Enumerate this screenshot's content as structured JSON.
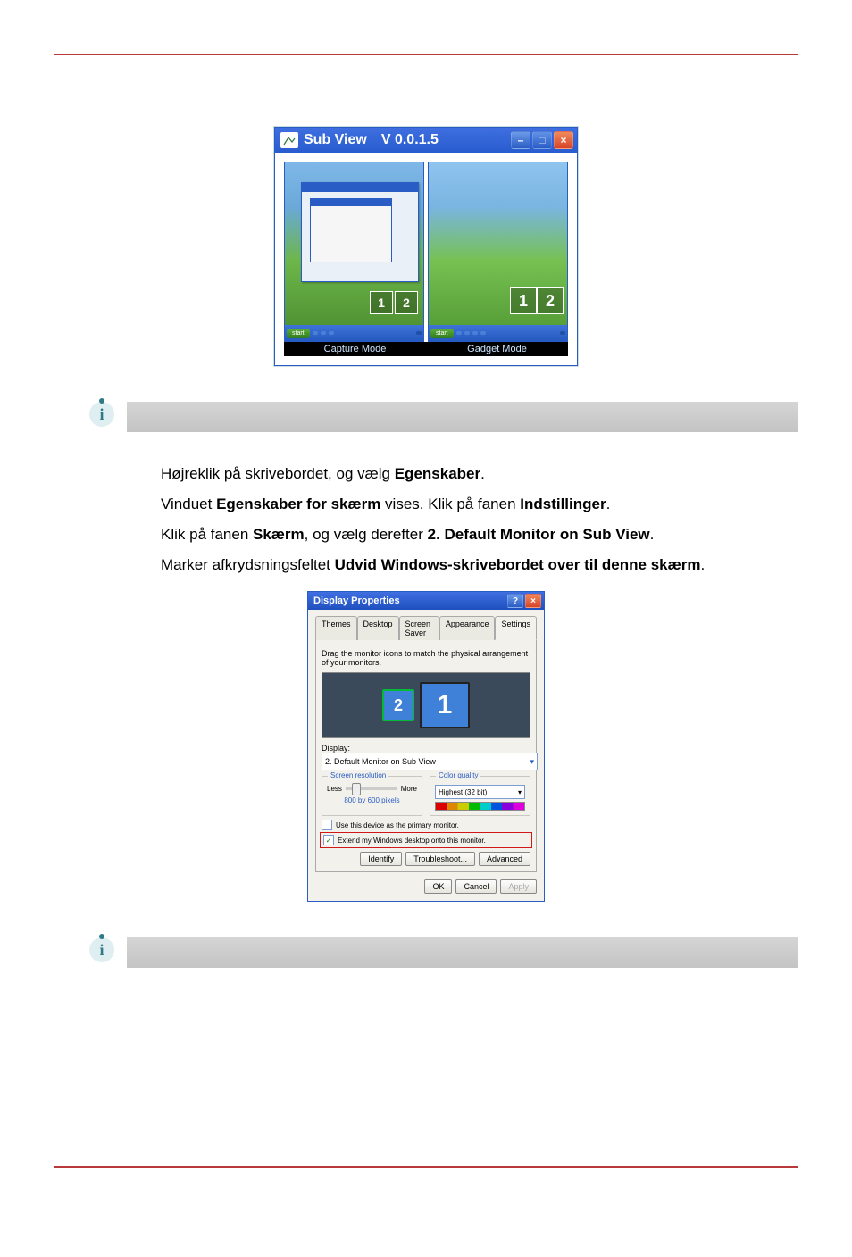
{
  "subview": {
    "title_prefix": "Sub View",
    "version": "V 0.0.1.5",
    "left_mode": "Capture Mode",
    "right_mode": "Gadget Mode",
    "badge_one": "1",
    "badge_two": "2"
  },
  "paragraph": {
    "line1_pre": "Højreklik på skrivebordet, og vælg ",
    "egenskaber": "Egenskaber",
    "line1_post": ".",
    "line2_pre": "Vinduet ",
    "egenskaber_skaerm": "Egenskaber for skærm",
    "line2_mid": " vises. Klik på fanen ",
    "indstillinger": "Indstillinger",
    "line2_post": ".",
    "line3_pre": "Klik på fanen ",
    "skaerm": "Skærm",
    "line3_mid": ", og vælg derefter ",
    "default_monitor": "2. Default Monitor on Sub View",
    "line3_post": ".",
    "line4_pre": "Marker afkrydsningsfeltet ",
    "udvid": "Udvid Windows-skrivebordet over til denne skærm",
    "line4_post": "."
  },
  "dp": {
    "title": "Display Properties",
    "tabs": {
      "themes": "Themes",
      "desktop": "Desktop",
      "saver": "Screen Saver",
      "appearance": "Appearance",
      "settings": "Settings"
    },
    "hint": "Drag the monitor icons to match the physical arrangement of your monitors.",
    "mon1": "1",
    "mon2": "2",
    "display_label": "Display:",
    "display_value": "2. Default Monitor on Sub View",
    "res_legend": "Screen resolution",
    "res_less": "Less",
    "res_more": "More",
    "res_value": "800 by 600 pixels",
    "cq_legend": "Color quality",
    "cq_value": "Highest (32 bit)",
    "chk_primary": "Use this device as the primary monitor.",
    "chk_extend": "Extend my Windows desktop onto this monitor.",
    "check_mark": "✓",
    "btn_identify": "Identify",
    "btn_trouble": "Troubleshoot...",
    "btn_advanced": "Advanced",
    "btn_ok": "OK",
    "btn_cancel": "Cancel",
    "btn_apply": "Apply"
  }
}
